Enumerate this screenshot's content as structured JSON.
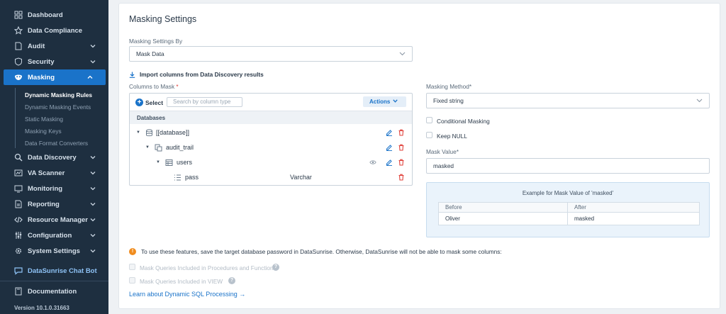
{
  "sidebar": {
    "items": [
      {
        "label": "Dashboard",
        "icon": "dashboard-icon"
      },
      {
        "label": "Data Compliance",
        "icon": "compliance-icon"
      },
      {
        "label": "Audit",
        "icon": "audit-icon"
      },
      {
        "label": "Security",
        "icon": "shield-icon"
      },
      {
        "label": "Masking",
        "icon": "masking-icon"
      },
      {
        "label": "Data Discovery",
        "icon": "search-icon"
      },
      {
        "label": "VA Scanner",
        "icon": "scanner-icon"
      },
      {
        "label": "Monitoring",
        "icon": "monitoring-icon"
      },
      {
        "label": "Reporting",
        "icon": "reporting-icon"
      },
      {
        "label": "Resource Manager",
        "icon": "code-icon"
      },
      {
        "label": "Configuration",
        "icon": "sliders-icon"
      },
      {
        "label": "System Settings",
        "icon": "gear-icon"
      }
    ],
    "masking_sub": [
      "Dynamic Masking Rules",
      "Dynamic Masking Events",
      "Static Masking",
      "Masking Keys",
      "Data Format Converters"
    ],
    "chatbot": "DataSunrise Chat Bot",
    "documentation": "Documentation",
    "version": "Version 10.1.0.31663"
  },
  "main": {
    "title": "Masking Settings",
    "masking_by_label": "Masking Settings By",
    "masking_by_value": "Mask Data",
    "import_label": "Import columns from Data Discovery results",
    "columns_label": "Columns to Mask",
    "required_mark": "*",
    "tree": {
      "select_label": "Select",
      "search_placeholder": "Search by column type",
      "actions_label": "Actions",
      "header": "Databases",
      "rows": [
        {
          "name": "[[database]]",
          "type": ""
        },
        {
          "name": "audit_trail",
          "type": ""
        },
        {
          "name": "users",
          "type": ""
        },
        {
          "name": "pass",
          "type": "Varchar"
        }
      ]
    },
    "method_label": "Masking Method*",
    "method_value": "Fixed string",
    "conditional_label": "Conditional Masking",
    "keep_null_label": "Keep NULL",
    "mask_value_label": "Mask Value*",
    "mask_value": "masked",
    "example": {
      "title": "Example for Mask Value of 'masked'",
      "headers": [
        "Before",
        "After"
      ],
      "row": [
        "Oliver",
        "masked"
      ]
    },
    "warning": "To use these features, save the target database password in DataSunrise. Otherwise, DataSunrise will not be able to mask some columns:",
    "opt_procedures": "Mask Queries Included in Procedures and Functions",
    "opt_view": "Mask Queries Included in VIEW",
    "link": "Learn about Dynamic SQL Processing",
    "link_arrow": "→"
  },
  "colors": {
    "accent": "#1a73c9",
    "sidebar": "#1e2f40",
    "danger": "#e0403a",
    "warning": "#f08c1e"
  }
}
